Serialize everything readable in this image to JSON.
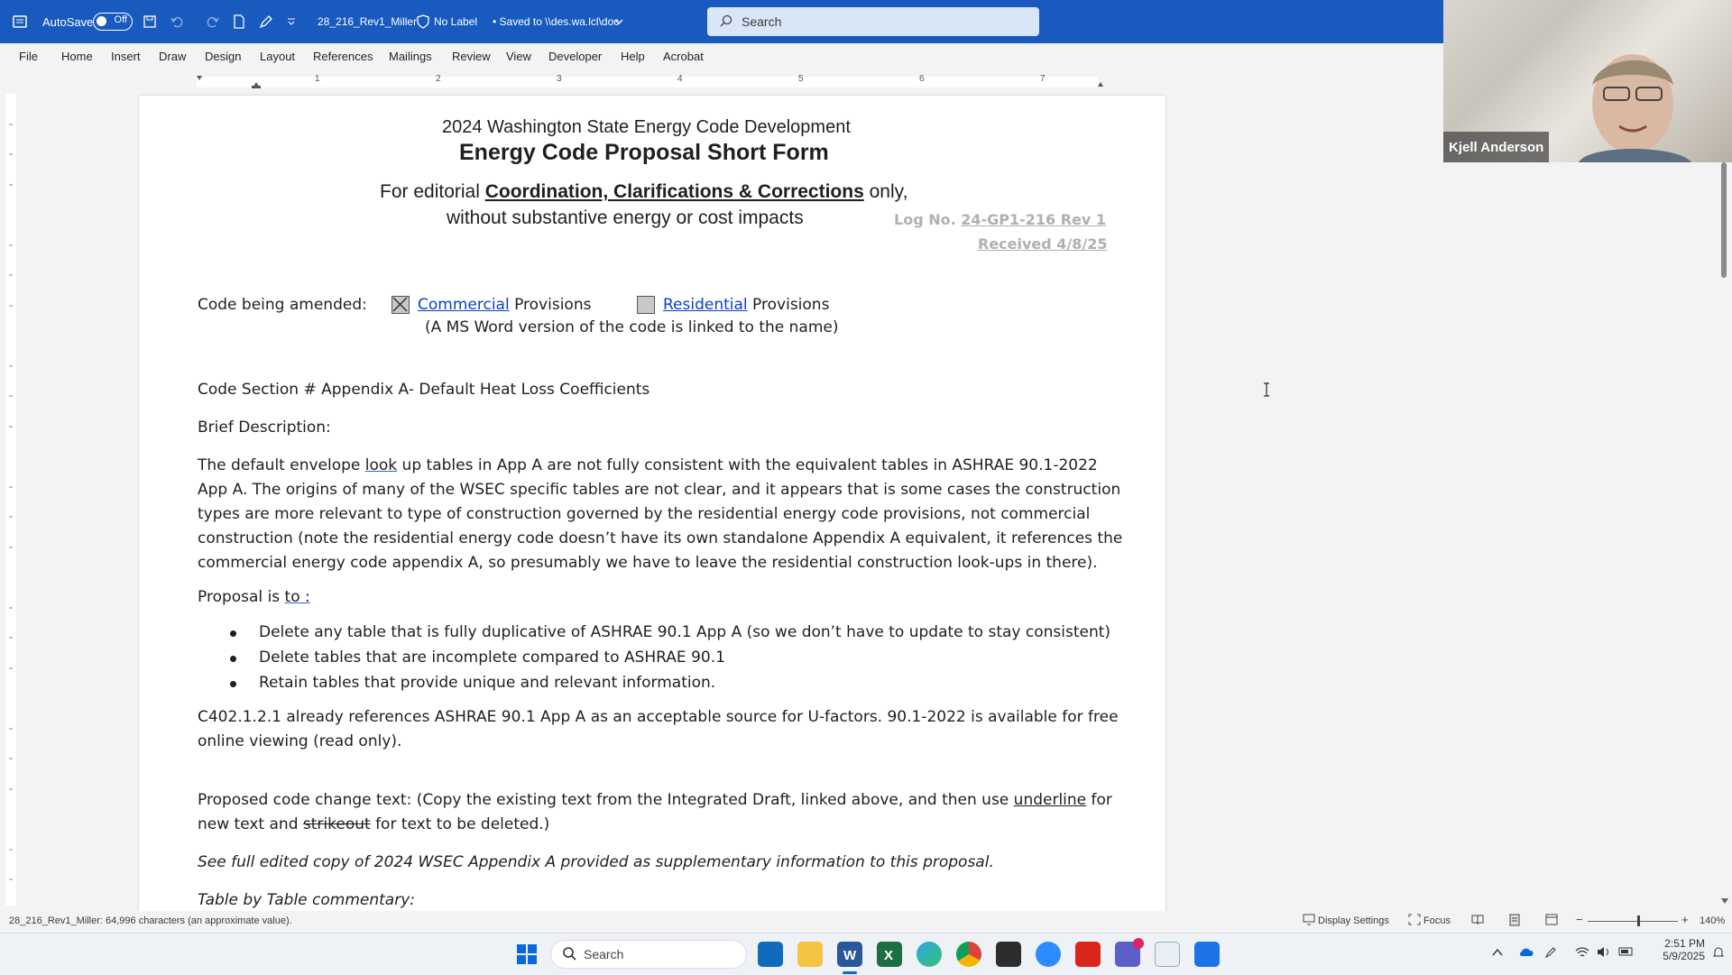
{
  "titlebar": {
    "autosave_label": "AutoSave",
    "autosave_state": "Off",
    "doc_name": "28_216_Rev1_Miller",
    "sensitivity": "No Label",
    "saved_status": "• Saved to \\\\des.wa.lcl\\doc",
    "search_placeholder": "Search"
  },
  "menu": [
    "File",
    "Home",
    "Insert",
    "Draw",
    "Design",
    "Layout",
    "References",
    "Mailings",
    "Review",
    "View",
    "Developer",
    "Help",
    "Acrobat"
  ],
  "webcam": {
    "participant_name": "Kjell Anderson"
  },
  "ruler_numbers": [
    "1",
    "2",
    "3",
    "4",
    "5",
    "6",
    "7"
  ],
  "document": {
    "header_line1": "2024 Washington State Energy Code Development",
    "header_line2": "Energy Code Proposal Short Form",
    "editorial_prefix": "For editorial ",
    "editorial_bold": "Coordination, Clarifications & Corrections",
    "editorial_suffix": " only,",
    "editorial_line2": "without substantive energy or cost impacts",
    "log_prefix": "Log No. ",
    "log_number": "24-GP1-216 Rev 1",
    "received": "Received 4/8/25",
    "code_amended_label": "Code being amended:",
    "commercial_link": "Commercial",
    "commercial_suffix": " Provisions",
    "commercial_checked": true,
    "residential_link": "Residential",
    "residential_suffix": " Provisions",
    "residential_checked": false,
    "ms_word_note": "(A MS Word version of the code is linked to the name)",
    "code_section": "Code Section # Appendix A- Default Heat Loss Coefficients",
    "brief_description_label": "Brief Description:",
    "desc_line1_a": "The default envelope ",
    "desc_line1_b": "look",
    "desc_line1_c": " up tables in App A are not fully consistent with the equivalent tables in ASHRAE 90.1-2022",
    "desc_line2": "App A. The origins of many of the WSEC specific tables are not clear, and it appears that is some cases the construction",
    "desc_line3": "types are more relevant to type of construction governed by the residential energy code provisions, not commercial",
    "desc_line4": "construction (note the residential energy code doesn’t have its own standalone Appendix A equivalent, it references the",
    "desc_line5": "commercial energy code appendix A, so presumably we have to leave the residential construction look-ups in there).",
    "proposal_prefix": "Proposal is ",
    "proposal_wavy": "to :",
    "bullets": [
      "Delete any table that is fully duplicative of ASHRAE 90.1 App A (so we don’t have to update to stay consistent)",
      "Delete tables that are incomplete compared to ASHRAE 90.1",
      "Retain tables that provide unique and relevant information."
    ],
    "c402_line1": "C402.1.2.1 already references ASHRAE 90.1 App A as an acceptable source for U-factors. 90.1-2022 is available for free",
    "c402_line2": "online viewing (read only).",
    "proposed_line1_a": "Proposed code change text: (Copy the existing text from the Integrated Draft, linked above, and then use ",
    "proposed_line1_b": "underline",
    "proposed_line1_c": " for",
    "proposed_line2_a": "new text and ",
    "proposed_line2_b": "strikeout",
    "proposed_line2_c": " for text to be deleted.)",
    "see_full": "See full edited copy of 2024 WSEC Appendix A provided as supplementary information to this proposal.",
    "table_commentary": "Table by Table commentary:"
  },
  "statusbar": {
    "word_count": "28_216_Rev1_Miller: 64,996 characters (an approximate value).",
    "display_settings": "Display Settings",
    "focus": "Focus",
    "zoom": "140%",
    "zoom_fraction": 0.56
  },
  "taskbar": {
    "search_placeholder": "Search",
    "time": "2:51 PM",
    "date": "5/9/2025"
  },
  "colors": {
    "titlebar": "#185abd",
    "link": "#0b3fcf"
  }
}
